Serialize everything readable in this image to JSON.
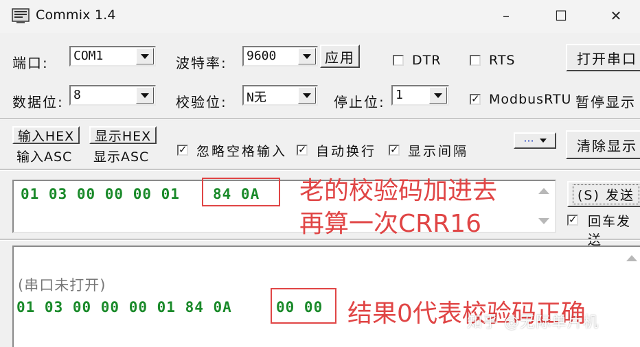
{
  "window": {
    "title": "Commix 1.4",
    "minimize": "–",
    "maximize": "☐",
    "close": "✕"
  },
  "row1": {
    "port_label": "端口:",
    "port_value": "COM1",
    "baud_label": "波特率:",
    "baud_value": "9600",
    "apply_label": "应用",
    "dtr_label": "DTR",
    "rts_label": "RTS",
    "open_port_label": "打开串口"
  },
  "row2": {
    "databits_label": "数据位:",
    "databits_value": "8",
    "parity_label": "校验位:",
    "parity_value": "N无",
    "stopbits_label": "停止位:",
    "stopbits_value": "1",
    "modbus_label": "ModbusRTU",
    "pause_label": "暂停显示"
  },
  "row3": {
    "input_hex": "输入HEX",
    "input_asc": "输入ASC",
    "display_hex": "显示HEX",
    "display_asc": "显示ASC",
    "ignore_space_label": "忽略空格输入",
    "auto_wrap_label": "自动换行",
    "show_interval_label": "显示间隔",
    "more_label": "···",
    "clear_display_label": "清除显示"
  },
  "send": {
    "data_a": "01 03 00 00 00 01",
    "data_b": "84 0A",
    "send_button": "发送",
    "send_key": "S",
    "enter_send_label": "回车发送"
  },
  "receive": {
    "status": "(串口未打开)",
    "data_a": "01 03 00 00 00 01 84 0A",
    "data_b": "00 00"
  },
  "annotations": {
    "line1": "老的校验码加进去",
    "line2": "再算一次CRR16",
    "result": "结果0代表校验码正确"
  },
  "watermark": "知乎 @无际单片机",
  "colors": {
    "hex_green": "#1a8a2a",
    "annotation_red": "#e04545"
  }
}
